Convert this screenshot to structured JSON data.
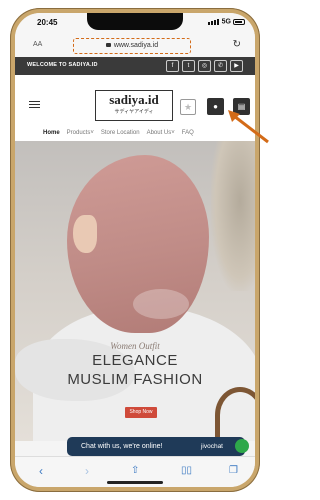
{
  "status": {
    "time": "20:45",
    "network": "5G"
  },
  "browser": {
    "text_size": "AA",
    "url": "www.sadiya.id",
    "reload_icon": "reload-icon",
    "bottom_icons": [
      "back-icon",
      "forward-icon",
      "share-icon",
      "bookmarks-icon",
      "tabs-icon"
    ]
  },
  "topbar": {
    "welcome": "WELCOME TO SADIYA.ID",
    "socials": [
      "facebook-icon",
      "twitter-icon",
      "instagram-icon",
      "phone-icon",
      "youtube-icon"
    ]
  },
  "header": {
    "logo": "sadiya.id",
    "logo_sub": "サディヤアイディ",
    "icons": [
      "hamburger-icon",
      "star-icon",
      "user-icon",
      "cart-icon"
    ]
  },
  "nav": [
    {
      "label": "Home",
      "active": true
    },
    {
      "label": "Products",
      "dropdown": true
    },
    {
      "label": "Store Location"
    },
    {
      "label": "About Us",
      "dropdown": true
    },
    {
      "label": "FAQ"
    }
  ],
  "hero": {
    "script": "Women Outfit",
    "line1": "ELEGANCE",
    "line2": "MUSLIM FASHION",
    "button": "Shop Now"
  },
  "chat": {
    "text": "Chat with us, we're online!",
    "brand": "jivochat"
  },
  "colors": {
    "phone_frame": "#c9a66b",
    "topbar": "#3a3a3a",
    "accent": "#cf4a3a",
    "chat": "#1f3a58",
    "highlight": "#d36b18",
    "ios_blue": "#3a78c2"
  }
}
